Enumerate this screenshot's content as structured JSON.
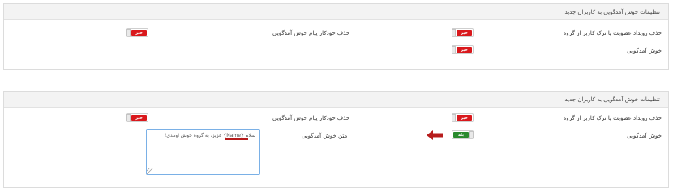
{
  "panel1": {
    "title": "تنظیمات خوش آمدگویی به کاربران جدید",
    "left_delete_label": "حذف خودکار پیام خوش آمدگویی",
    "right_delete_label": "حذف رویداد عضویت یا ترک کاربر از گروه",
    "welcome_label": "خوش آمدگویی",
    "left_toggle_text": "خیر",
    "right_delete_toggle_text": "خیر",
    "welcome_toggle_text": "خیر"
  },
  "panel2": {
    "title": "تنظیمات خوش آمدگویی به کاربران جدید",
    "left_delete_label": "حذف خودکار پیام خوش آمدگویی",
    "right_delete_label": "حذف رویداد عضویت یا ترک کاربر از گروه",
    "welcome_label": "خوش آمدگویی",
    "welcome_text_label": "متن خوش آمدگویی",
    "left_toggle_text": "خیر",
    "right_delete_toggle_text": "خیر",
    "welcome_toggle_text": "بله",
    "welcome_text_value": "سلام {Name} عزیز، به گروه خوش اومدی!"
  },
  "icons": {
    "arrow": "arrow-left-icon",
    "grip": "resize-grip-icon"
  },
  "colors": {
    "off_tag": "#d9181c",
    "on_tag": "#2a8a2e",
    "arrow": "#b71c1c",
    "textarea_border": "#7ab0e6"
  }
}
